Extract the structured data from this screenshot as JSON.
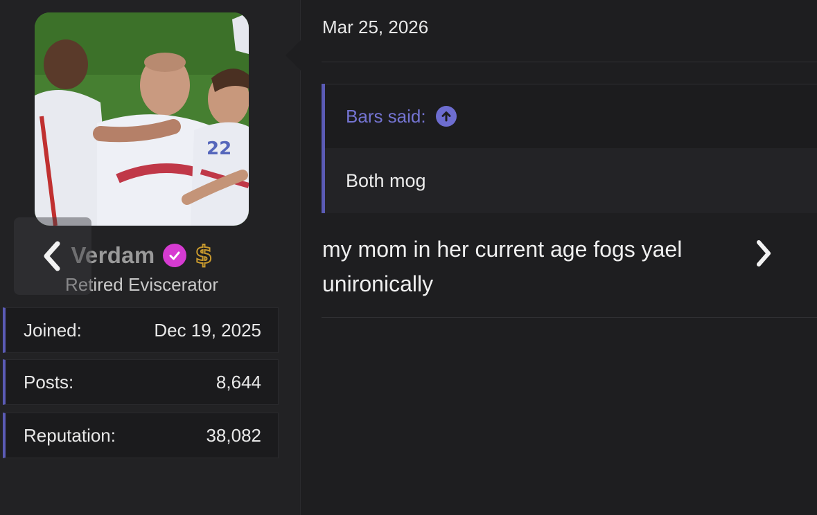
{
  "user": {
    "username": "Verdam",
    "title": "Retired Eviscerator",
    "badges": {
      "verified_icon": "check-badge-icon",
      "verified_color": "#d63bd1",
      "currency_icon": "dollar-sign-icon",
      "currency_symbol": "$",
      "currency_color": "#c99a2e"
    },
    "stats": [
      {
        "label": "Joined:",
        "value": "Dec 19, 2025"
      },
      {
        "label": "Posts:",
        "value": "8,644"
      },
      {
        "label": "Reputation:",
        "value": "38,082"
      }
    ]
  },
  "post": {
    "date": "Mar 25, 2026",
    "quote": {
      "attribution": "Bars said:",
      "body": "Both mog"
    },
    "message": "my mom in her current age fogs yael unironically"
  },
  "colors": {
    "accent": "#5b5bb5",
    "quote_link": "#7474d2",
    "background": "#1e1e20"
  },
  "nav": {
    "prev_icon": "chevron-left-icon",
    "next_icon": "chevron-right-icon"
  }
}
